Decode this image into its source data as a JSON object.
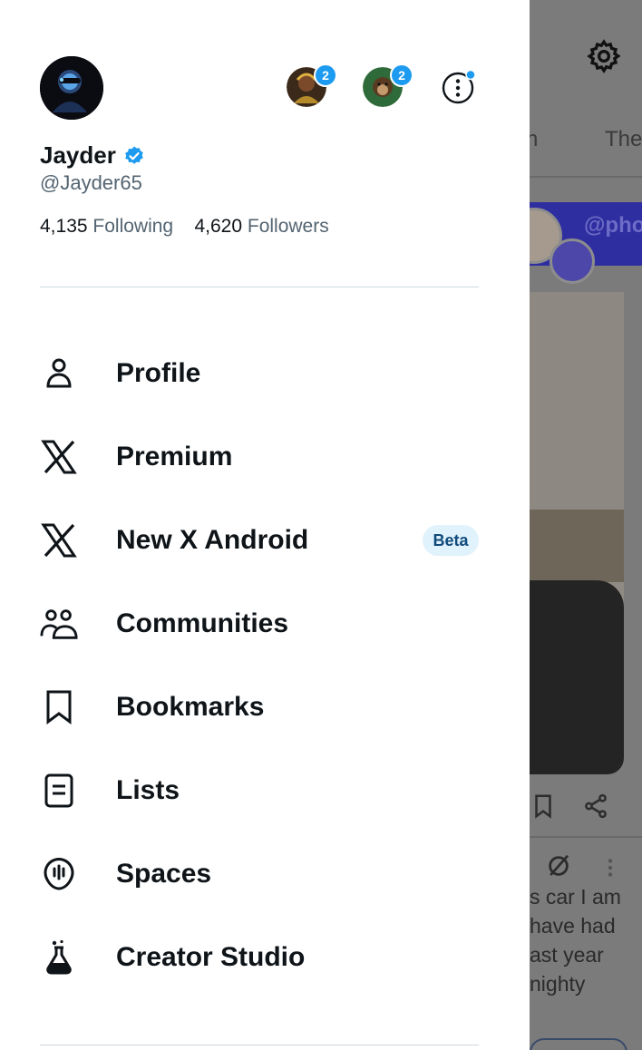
{
  "profile": {
    "name": "Jayder",
    "handle": "@Jayder65",
    "avatar_text": "Jayder",
    "verified": true,
    "following_count": "4,135",
    "following_label": "Following",
    "followers_count": "4,620",
    "followers_label": "Followers"
  },
  "accounts": [
    {
      "badge": "2",
      "icon": "account-avatar-1"
    },
    {
      "badge": "2",
      "icon": "account-avatar-2"
    }
  ],
  "menu": [
    {
      "label": "Profile",
      "icon": "person-icon"
    },
    {
      "label": "Premium",
      "icon": "x-logo-icon"
    },
    {
      "label": "New X Android",
      "icon": "x-logo-icon",
      "badge": "Beta"
    },
    {
      "label": "Communities",
      "icon": "communities-icon"
    },
    {
      "label": "Bookmarks",
      "icon": "bookmark-icon"
    },
    {
      "label": "Lists",
      "icon": "lists-icon"
    },
    {
      "label": "Spaces",
      "icon": "spaces-icon"
    },
    {
      "label": "Creator Studio",
      "icon": "flask-icon"
    }
  ],
  "background": {
    "tab_partial_1": "n",
    "tab_partial_2": "The",
    "banner_handle": "@pho",
    "post_lines": [
      "s car I am",
      "have had",
      "ast year",
      "nighty"
    ]
  },
  "colors": {
    "accent": "#1d9bf0",
    "beta_bg": "#e0f2fc",
    "secondary_text": "#536471",
    "overlay": "#7b7b7b"
  }
}
